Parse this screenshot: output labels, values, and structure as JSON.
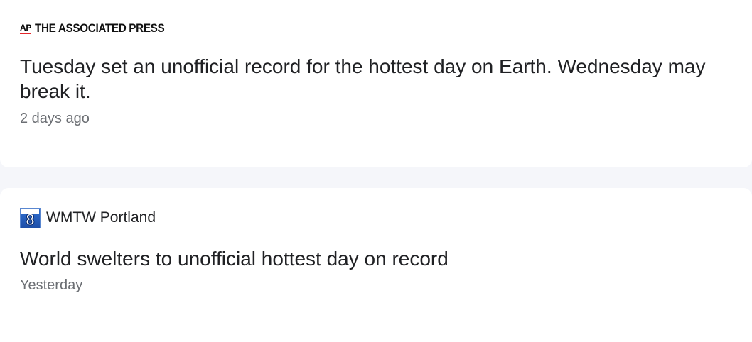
{
  "articles": [
    {
      "source": {
        "logo_text": "AP",
        "name": "THE ASSOCIATED PRESS",
        "logo_accent_color": "#e4262a",
        "icon": "ap-logo-icon"
      },
      "headline": "Tuesday set an unofficial record for the hottest day on Earth. Wednesday may break it.",
      "time": "2 days ago"
    },
    {
      "source": {
        "logo_text": "8",
        "name": "WMTW Portland",
        "logo_color": "#1e4fa8",
        "icon": "wmtw-8-logo-icon"
      },
      "headline": "World swelters to unofficial hottest day on record",
      "time": "Yesterday"
    }
  ]
}
